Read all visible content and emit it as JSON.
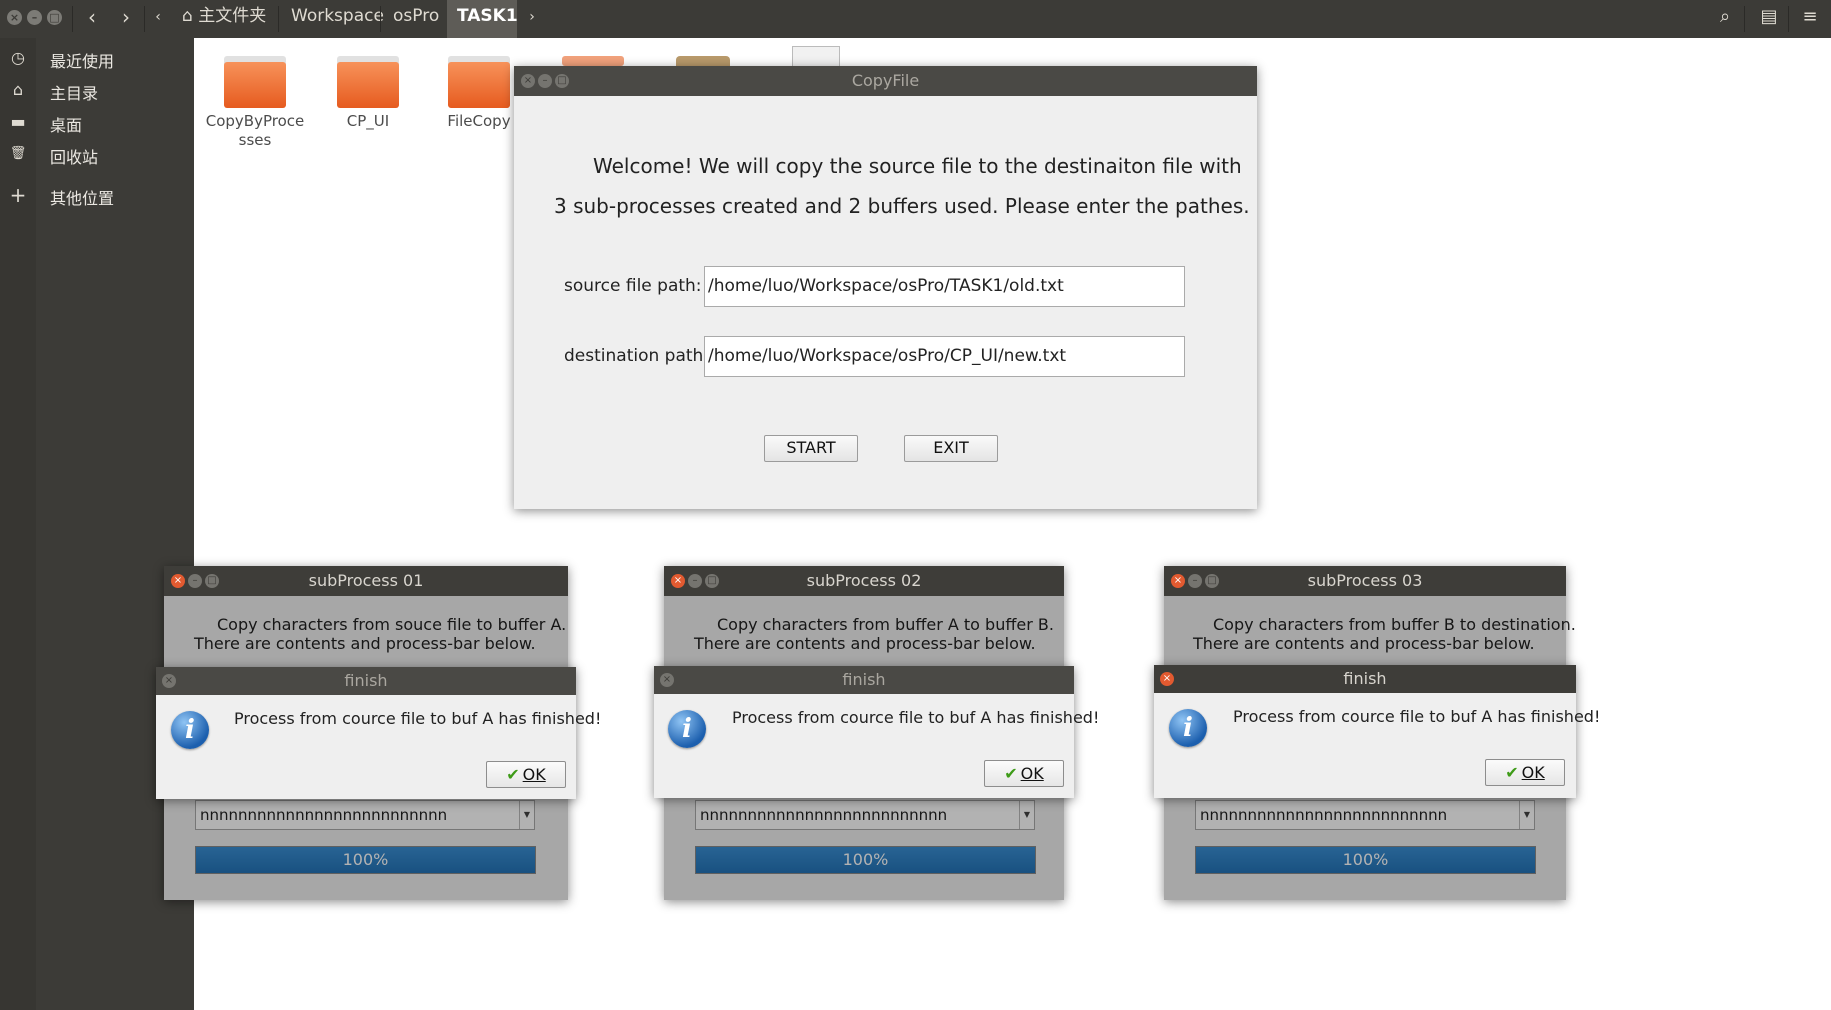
{
  "window_controls": {
    "close": "×",
    "min": "–",
    "max": "□"
  },
  "topbar": {
    "back": "‹",
    "forward": "›",
    "left_arrow": "‹",
    "right_arrow": "›",
    "home_icon": "⌂",
    "breadcrumbs": [
      "主文件夹",
      "Workspace",
      "osPro",
      "TASK1"
    ],
    "search_icon": "⌕",
    "view_icon": "▤",
    "menu_icon": "≡"
  },
  "sidebar": {
    "items": [
      {
        "label": "最近使用",
        "icon": "clock-icon",
        "glyph": "◷"
      },
      {
        "label": "主目录",
        "icon": "home-icon",
        "glyph": "⌂"
      },
      {
        "label": "桌面",
        "icon": "folder-icon",
        "glyph": "▬"
      },
      {
        "label": "回收站",
        "icon": "trash-icon",
        "glyph": "🗑"
      },
      {
        "label": "其他位置",
        "icon": "plus-icon",
        "glyph": "+"
      }
    ]
  },
  "files": [
    {
      "name": "CopyByProce\nsses"
    },
    {
      "name": "CP_UI"
    },
    {
      "name": "FileCopy"
    }
  ],
  "main_window": {
    "title": "CopyFile",
    "welcome_line1": "Welcome! We will copy the source file to the destinaiton file with",
    "welcome_line2": "3 sub-processes created and 2 buffers used. Please enter the pathes.",
    "source_label": "source file path:",
    "source_value": "/home/luo/Workspace/osPro/TASK1/old.txt",
    "dest_label": "destination path:",
    "dest_value": "/home/luo/Workspace/osPro/CP_UI/new.txt",
    "start_label": "START",
    "exit_label": "EXIT"
  },
  "subprocesses": [
    {
      "title": "subProcess 01",
      "line1": "Copy characters from souce file to buffer A.",
      "line2": "There are contents and process-bar below.",
      "buffer_text": "nnnnnnnnnnnnnnnnnnnnnnnnnn",
      "progress": 1.0,
      "progress_text": "100%",
      "dialog": {
        "title": "finish",
        "message": "Process from cource file to buf A has finished!",
        "ok": "OK"
      }
    },
    {
      "title": "subProcess 02",
      "line1": "Copy characters from buffer A to buffer B.",
      "line2": "There are contents and process-bar below.",
      "buffer_text": "nnnnnnnnnnnnnnnnnnnnnnnnnn",
      "progress": 1.0,
      "progress_text": "100%",
      "dialog": {
        "title": "finish",
        "message": "Process from cource file to buf A has finished!",
        "ok": "OK"
      }
    },
    {
      "title": "subProcess 03",
      "line1": "Copy characters from buffer B to destination.",
      "line2": "There are contents and process-bar below.",
      "buffer_text": "nnnnnnnnnnnnnnnnnnnnnnnnnn",
      "progress": 1.0,
      "progress_text": "100%",
      "dialog": {
        "title": "finish",
        "message": "Process from cource file to buf A has finished!",
        "ok": "OK"
      }
    }
  ],
  "colors": {
    "accent": "#e95420",
    "progress": "#2474b8",
    "titlebar": "#3c3b37"
  }
}
